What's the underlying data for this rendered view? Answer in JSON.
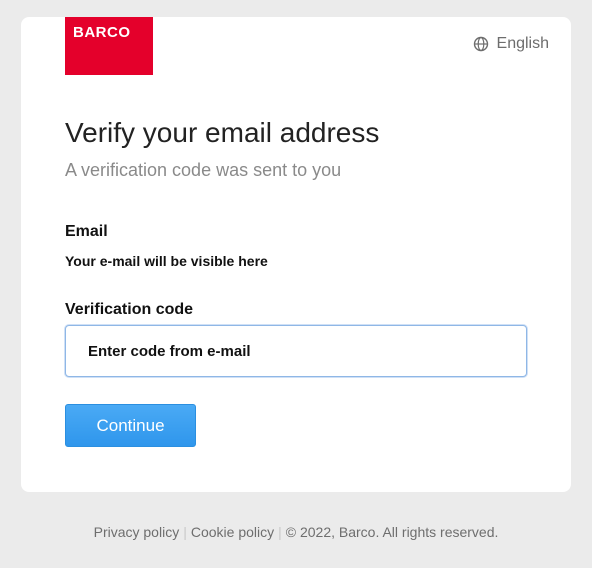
{
  "brand": {
    "logo_text": "BARCO",
    "logo_color": "#e4002b"
  },
  "header": {
    "language": "English",
    "language_icon": "globe-icon"
  },
  "main": {
    "title": "Verify your email address",
    "subtitle": "A verification code was sent to you",
    "email_label": "Email",
    "email_value": "Your e-mail will be visible here",
    "code_label": "Verification code",
    "code_placeholder": "Enter code from e-mail",
    "continue_label": "Continue",
    "accent_color": "#2f96ec"
  },
  "footer": {
    "privacy_label": "Privacy policy",
    "cookie_label": "Cookie policy",
    "separator": "|",
    "copyright": "© 2022, Barco. All rights reserved."
  }
}
